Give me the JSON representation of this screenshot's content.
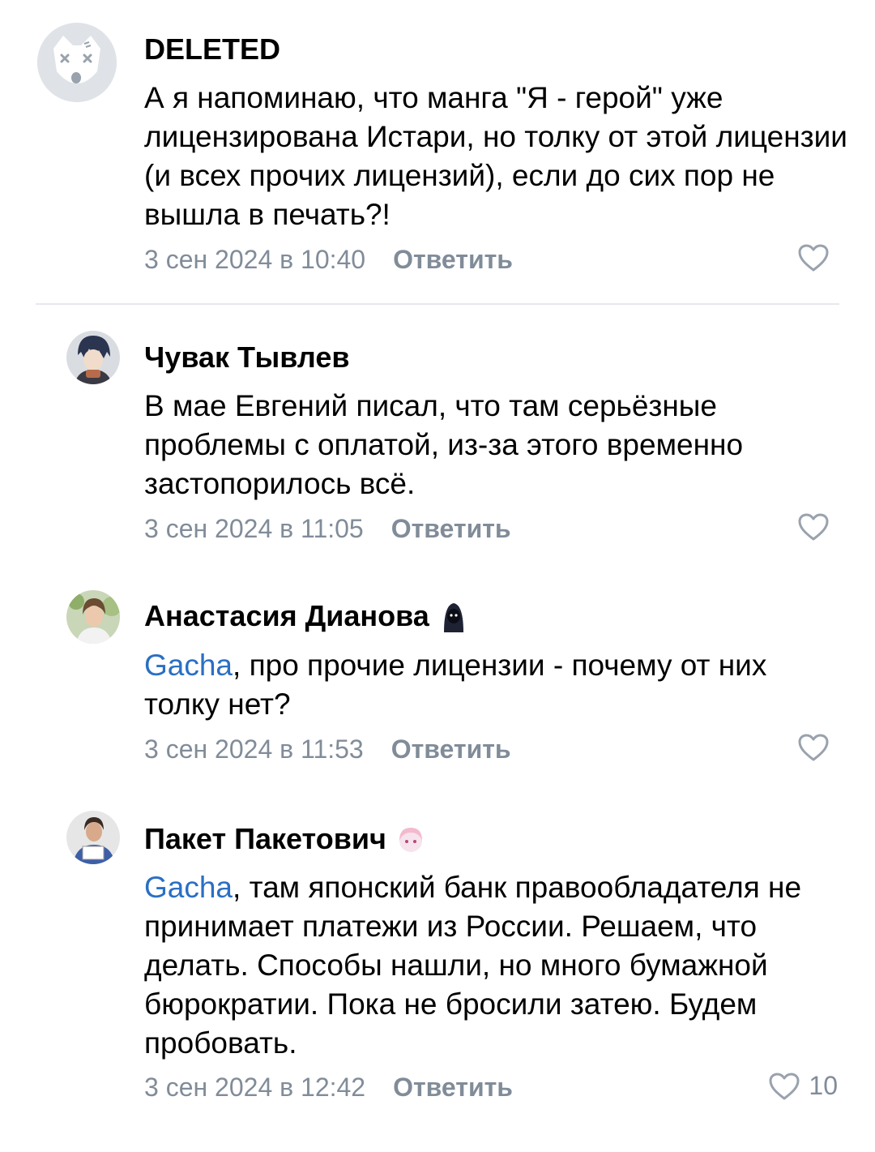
{
  "comments": [
    {
      "author": "DELETED",
      "text": "А я напоминаю, что манга \"Я - герой\" уже лицензирована Истари, но толку от этой лицензии (и всех прочих лицензий), если до сих пор не вышла в печать?!",
      "date": "3 сен 2024 в 10:40",
      "reply": "Ответить",
      "likes": ""
    },
    {
      "author": "Чувак Тывлев",
      "text": "В мае Евгений писал, что там серьёзные проблемы с оплатой, из-за этого временно застопорилось всё.",
      "date": "3 сен 2024 в 11:05",
      "reply": "Ответить",
      "likes": ""
    },
    {
      "author": "Анастасия Дианова",
      "mention": "Gacha",
      "text": ", про прочие лицензии - почему от них толку нет?",
      "date": "3 сен 2024 в 11:53",
      "reply": "Ответить",
      "likes": ""
    },
    {
      "author": "Пакет Пакетович",
      "mention": "Gacha",
      "text": ", там японский банк правообладателя не принимает платежи из России. Решаем, что делать. Способы нашли, но много бумажной бюрократии. Пока не бросили затею. Будем пробовать.",
      "date": "3 сен 2024 в 12:42",
      "reply": "Ответить",
      "likes": "10"
    }
  ],
  "icons": {
    "like": "heart-outline-icon",
    "deleted_avatar": "deleted-dog-icon"
  },
  "colors": {
    "meta": "#818c99",
    "mention": "#2a6fc4",
    "divider": "#e7e8ec"
  }
}
